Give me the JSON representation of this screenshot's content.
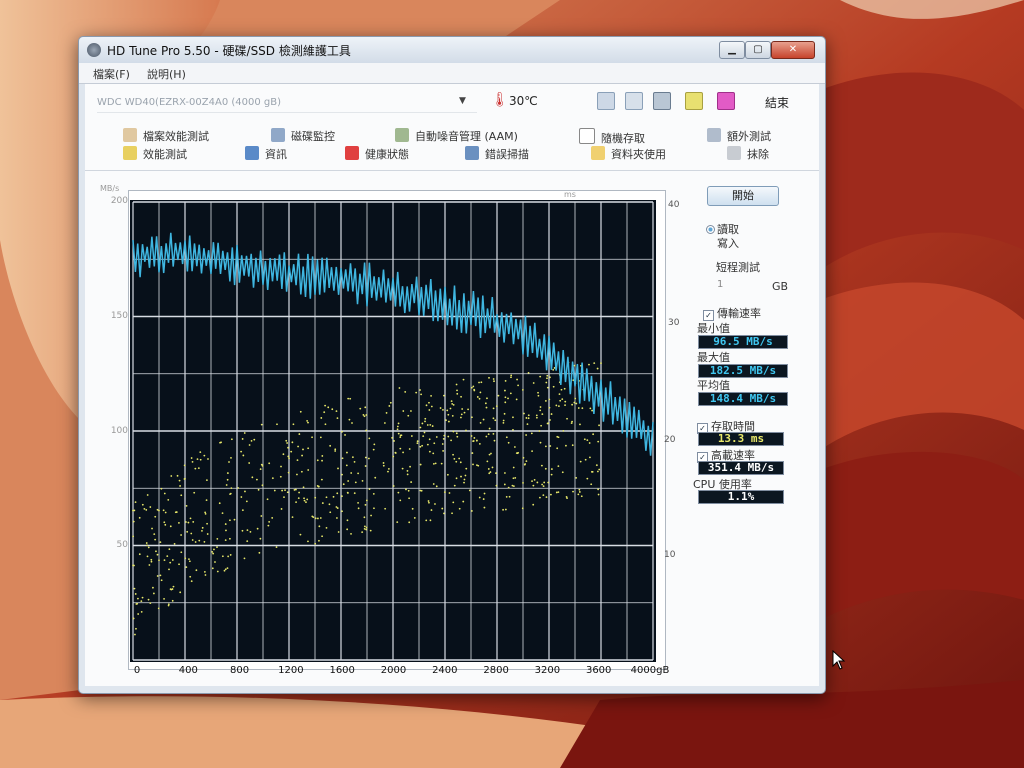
{
  "window": {
    "title": "HD Tune Pro 5.50 - 硬碟/SSD 檢測維護工具",
    "buttons": {
      "minimize": "▁",
      "maximize": "▢",
      "close": "✕"
    }
  },
  "menu": [
    {
      "label": "檔案(F)"
    },
    {
      "label": "說明(H)"
    }
  ],
  "toolbar": {
    "drive": "WDC WD40(EZRX-00Z4A0 (4000 gB)",
    "temperature": "30℃",
    "exit_label": "結束"
  },
  "tabs": [
    {
      "label": "檔案效能測試"
    },
    {
      "label": "磁碟監控"
    },
    {
      "label": "自動噪音管理 (AAM)"
    },
    {
      "label": "隨機存取"
    },
    {
      "label": "額外測試"
    },
    {
      "label": "效能測試"
    },
    {
      "label": "資訊"
    },
    {
      "label": "健康狀態"
    },
    {
      "label": "錯誤掃描"
    },
    {
      "label": "資料夾使用"
    },
    {
      "label": "抹除"
    }
  ],
  "side_panel": {
    "start_label": "開始",
    "read_label": "讀取",
    "write_label": "寫入",
    "short_test_label": "短程測試",
    "gb_value": "1",
    "gb_unit": "GB",
    "transfer_label": "傳輸速率",
    "min_label": "最小值",
    "min_value": "96.5 MB/s",
    "max_label": "最大值",
    "max_value": "182.5 MB/s",
    "avg_label": "平均值",
    "avg_value": "148.4 MB/s",
    "access_label": "存取時間",
    "access_value": "13.3 ms",
    "burst_label": "高載速率",
    "burst_value": "351.4 MB/s",
    "cpu_label": "CPU 使用率",
    "cpu_value": "1.1%",
    "colors": {
      "transfer": "#3fb6e0",
      "access": "#e8e86a",
      "plot_bg": "#07101a"
    }
  },
  "chart_data": {
    "type": "line",
    "x_ticks": [
      "0",
      "400",
      "800",
      "1200",
      "1600",
      "2000",
      "2400",
      "2800",
      "3200",
      "3600",
      "4000gB"
    ],
    "y_left_unit": "MB/s",
    "y_left_ticks": [
      "200",
      "150",
      "100",
      "50"
    ],
    "y_right_unit": "ms",
    "y_right_ticks": [
      "40",
      "30",
      "20",
      "10"
    ],
    "xlim": [
      0,
      4000
    ],
    "ylim_left": [
      0,
      200
    ],
    "ylim_right": [
      0,
      40
    ],
    "grid": true,
    "series": [
      {
        "x": [
          0,
          160,
          320,
          480,
          640,
          800,
          960,
          1120,
          1280,
          1440,
          1600,
          1760,
          1920,
          2080,
          2240,
          2400,
          2560,
          2720,
          2880,
          3040,
          3200,
          3360,
          3520,
          3680,
          3840,
          4000
        ],
        "values": [
          177,
          177,
          178,
          177,
          175,
          173,
          171,
          170,
          168,
          167,
          166,
          164,
          163,
          160,
          158,
          155,
          152,
          150,
          146,
          141,
          133,
          126,
          117,
          112,
          104,
          96.5
        ]
      },
      {
        "x": [
          0,
          200,
          400,
          600,
          800,
          1000,
          1200,
          1400,
          1600,
          1800,
          2000,
          2200,
          2400,
          2600,
          2800,
          3000,
          3200,
          3400,
          3600
        ],
        "values": [
          8,
          10,
          12,
          13,
          14,
          15,
          16,
          16,
          17,
          17,
          18,
          18,
          18,
          19,
          19,
          19,
          20,
          20,
          20
        ]
      }
    ]
  }
}
